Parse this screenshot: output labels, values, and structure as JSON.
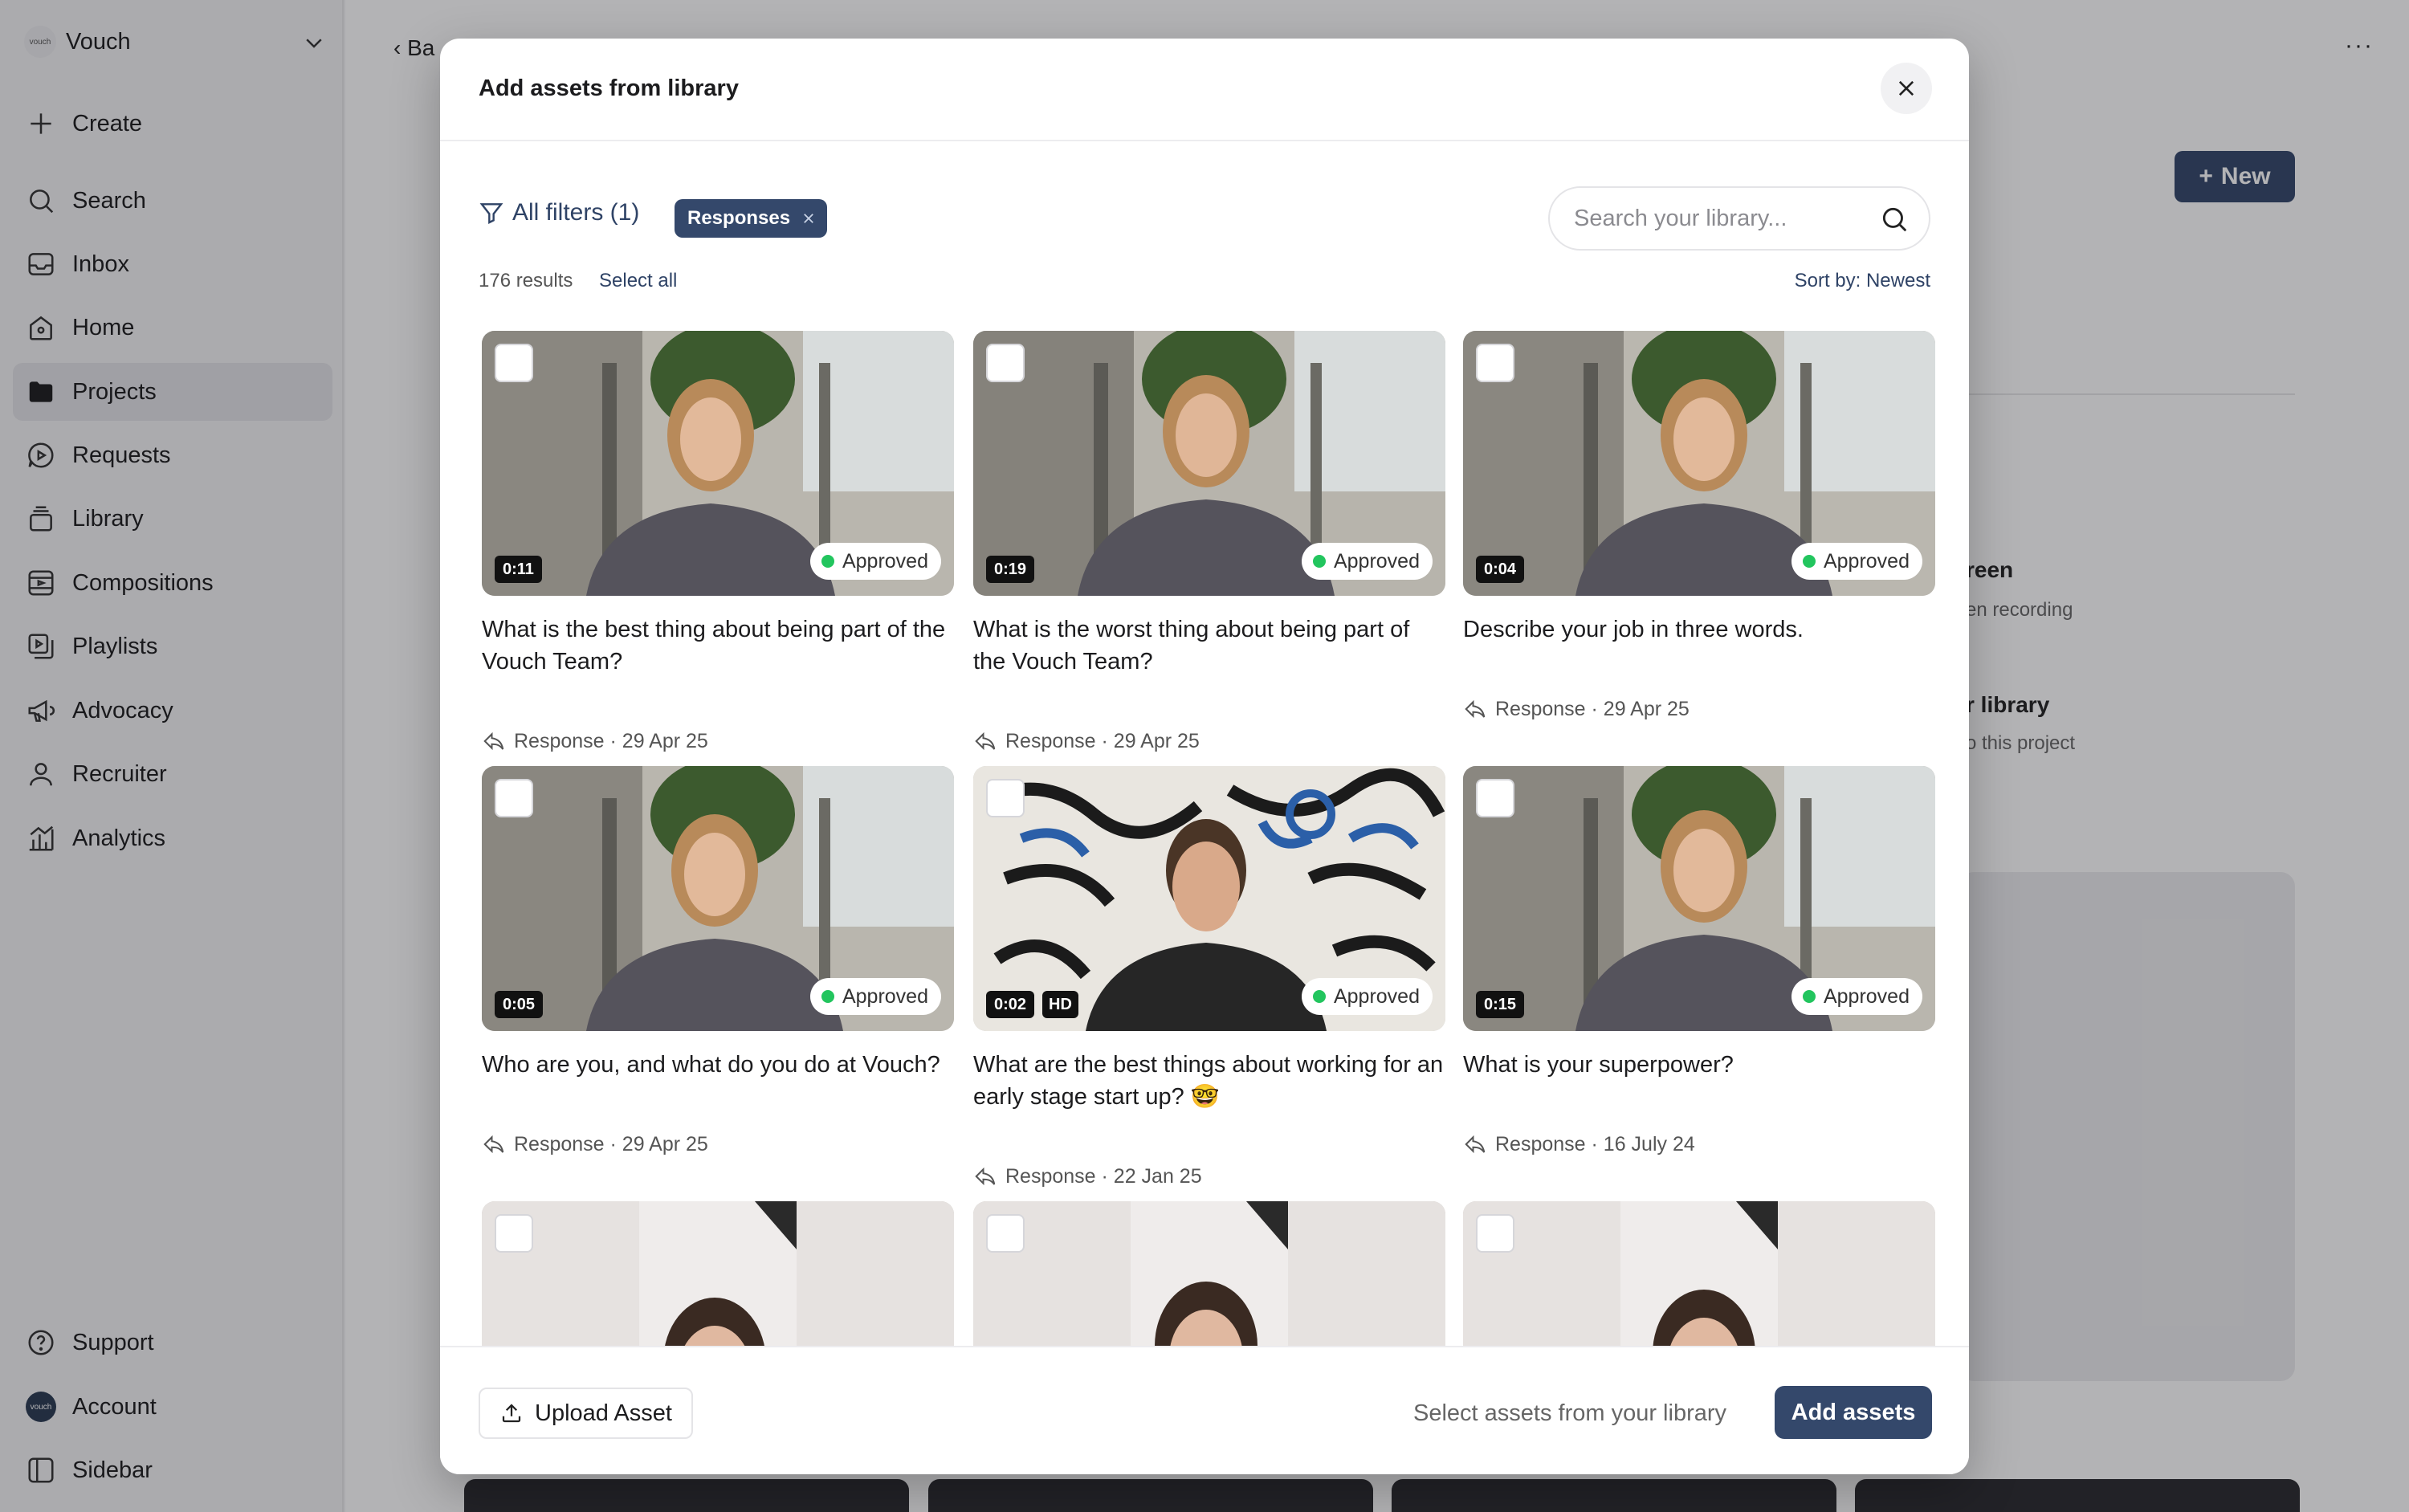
{
  "workspace": {
    "logo_text": "vouch",
    "name": "Vouch"
  },
  "nav": {
    "create": "Create",
    "search": "Search",
    "inbox": "Inbox",
    "home": "Home",
    "projects": "Projects",
    "requests": "Requests",
    "library": "Library",
    "compositions": "Compositions",
    "playlists": "Playlists",
    "advocacy": "Advocacy",
    "recruiter": "Recruiter",
    "analytics": "Analytics",
    "support": "Support",
    "account": "Account",
    "account_avatar_text": "vouch",
    "sidebar": "Sidebar"
  },
  "background": {
    "back_label": "Ba",
    "more": "···",
    "new_label": "New",
    "option1_title": "reen",
    "option1_sub": "en recording",
    "option2_title": "r library",
    "option2_sub": "o this project"
  },
  "modal": {
    "title": "Add assets from library",
    "filters_label": "All filters (1)",
    "active_filter": "Responses",
    "search_placeholder": "Search your library...",
    "results_count": "176 results",
    "select_all": "Select all",
    "sort_label": "Sort by: Newest",
    "cards": [
      {
        "duration": "0:11",
        "status": "Approved",
        "title": "What is the best thing about being part of the Vouch Team?",
        "meta": "Response · 29 Apr 25"
      },
      {
        "duration": "0:19",
        "status": "Approved",
        "title": "What is the worst thing about being part of the Vouch Team?",
        "meta": "Response · 29 Apr 25"
      },
      {
        "duration": "0:04",
        "status": "Approved",
        "title": "Describe your job in three words.",
        "meta": "Response · 29 Apr 25"
      },
      {
        "duration": "0:05",
        "status": "Approved",
        "title": "Who are you, and what do you do at Vouch?",
        "meta": "Response · 29 Apr 25"
      },
      {
        "duration": "0:02",
        "hd": "HD",
        "status": "Approved",
        "title": "What are the best things about working for an early stage start up? 🤓",
        "meta": "Response · 22 Jan 25"
      },
      {
        "duration": "0:15",
        "status": "Approved",
        "title": "What is your superpower?",
        "meta": "Response · 16 July 24"
      }
    ],
    "upload_label": "Upload Asset",
    "footer_hint": "Select assets from your library",
    "add_label": "Add assets"
  },
  "colors": {
    "accent": "#34486b",
    "approved": "#22c55e"
  }
}
